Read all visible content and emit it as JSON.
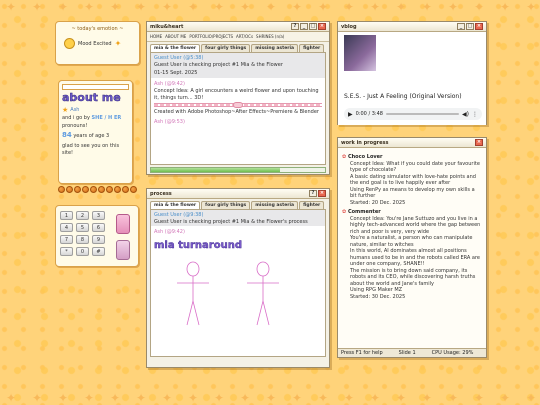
{
  "mood": {
    "title": "~ today's emotion ~",
    "status": "Mood Excited"
  },
  "about": {
    "heading": "about me",
    "name_label": "Ash",
    "pronouns_text": "and i go by",
    "pronouns_value": "SHE / H ER",
    "pronouns_suffix": "pronouns!",
    "age_text": "years of age 3",
    "age_value": "84",
    "greet": "glad to see you on this site!"
  },
  "keypad": {
    "keys": [
      "1",
      "2",
      "3",
      "4",
      "5",
      "6",
      "7",
      "8",
      "9",
      "*",
      "0",
      "#"
    ]
  },
  "main_window": {
    "title": "miku&heart",
    "menu": [
      "HOME",
      "ABOUT ME",
      "PORTFOLIO/PROJECTS",
      "ART/OCs",
      "SHRINES (n/a)"
    ],
    "tabs": [
      "mia & the flower",
      "four girly things",
      "missing asteria",
      "fighter"
    ],
    "guest_user": "Guest User (@5:38)",
    "guest_line": "Guest User is checking project #1 Mia & the Flower",
    "date": "01-15 Sept. 2025",
    "ash_tag": "Ash (@9:42)",
    "concept": "Concept Idea: A girl encounters a weird flower and upon touching it, things turn... 3D!",
    "created": "Created with Adobe Photoshop~After Effects~Premiere & Blender",
    "ash_tag2": "Ash (@9:53)",
    "progress": 0.74
  },
  "process_window": {
    "title": "process",
    "tabs": [
      "mia & the flower",
      "four girly things",
      "missing asteria",
      "fighter"
    ],
    "guest_user": "Guest User (@9:38)",
    "guest_line": "Guest User is checking project #1 Mia & the Flower's process",
    "ash_tag": "Ash (@9:42)",
    "turnaround": "mia turnaround"
  },
  "vblog": {
    "title": "vblog",
    "song": "S.E.S. - Just A Feeling (Original Version)",
    "time": "0:00 / 3:48"
  },
  "wip": {
    "title": "work in progress",
    "sections": [
      {
        "heading": "Choco Lover",
        "bullets": [
          "Concept Idea: What if you could date your favourite type of chocolate?",
          "A basic dating simulator with love-hate points and the end goal is to live happily ever after",
          "Using RenPy as means to develop my own skills a bit further",
          "Started: 20 Dec. 2025"
        ]
      },
      {
        "heading": "Commenter",
        "bullets": [
          "Concept Idea: You're Jane Suttuzo and you live in a highly tech-advanced world where the gap between rich and poor is very, very wide",
          "You're a naturalist, a person who can manipulate nature, similar to witches",
          "In this world, AI dominates almost all positions humans used to be in and the robots called ERA are under one company, SHANE!!",
          "The mission is to bring down said company, its robots and its CEO, while discovering harsh truths about the world and Jane's family",
          "Using RPG Maker MZ",
          "Started: 30 Dec. 2025"
        ]
      }
    ]
  },
  "status_bar": {
    "help": "Press F1 for help",
    "slide": "Slide 1",
    "cpu": "CPU Usage: 29%"
  },
  "colors": {
    "background": "#ffd37a",
    "accent_pink": "#d277b8",
    "accent_blue": "#4a8ec9",
    "window_close": "#e8674f"
  }
}
